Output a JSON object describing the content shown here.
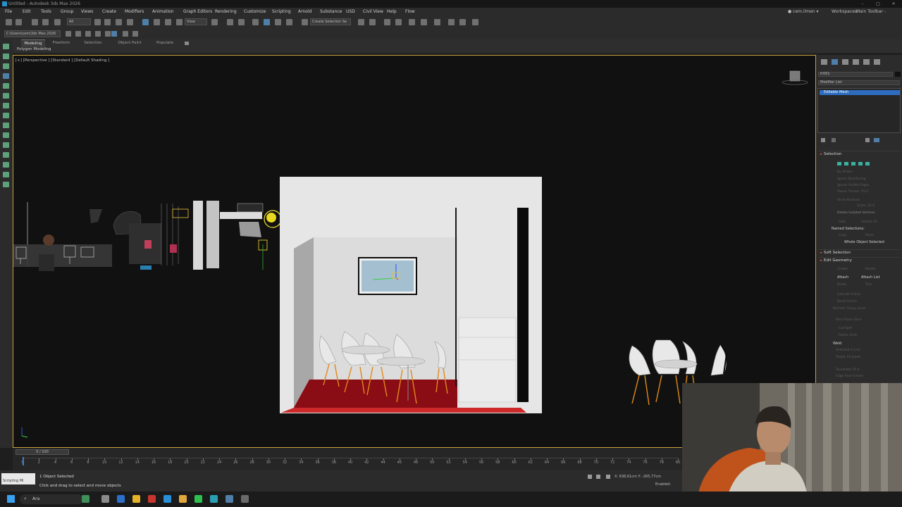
{
  "window": {
    "title": "Untitled - Autodesk 3ds Max 2026"
  },
  "menu": {
    "items": [
      "File",
      "Edit",
      "Tools",
      "Group",
      "Views",
      "Create",
      "Modifiers",
      "Animation",
      "Graph Editors",
      "Rendering",
      "Customize",
      "Scripting",
      "Arnold",
      "Substance",
      "USD",
      "Civil View",
      "Help",
      "Flow"
    ],
    "user": "cem.ilmen",
    "workspaces_label": "Workspaces:",
    "workspace_value": "Main Toolbar - modular"
  },
  "toolbar": {
    "filter_value": "All",
    "view_value": "View",
    "selection_set_placeholder": "Create Selection Se",
    "project_path": "C:\\Users\\cem\\3ds Max 2026"
  },
  "ribbon": {
    "tabs": [
      "Modeling",
      "Freeform",
      "Selection",
      "Object Paint",
      "Populate"
    ],
    "active_panel": "Polygon Modeling"
  },
  "viewport": {
    "label": "[+] [Perspective ] [Standard ] [Default Shading ]"
  },
  "command_panel": {
    "object_name": "tr001",
    "modifier_list_label": "Modifier List",
    "stack_item": "Editable Mesh",
    "rollouts": {
      "selection": "Selection",
      "soft_selection": "Soft Selection",
      "edit_geometry": "Edit Geometry"
    },
    "selection_options": [
      "By Vertex",
      "Ignore Backfacing",
      "Ignore Visible Edges",
      "Planar Thresh: 45.0",
      "Show Normals",
      "Scale: 20.0",
      "Delete Isolated Vertices"
    ],
    "hide_label": "Hide",
    "unhide_all_label": "Unhide All",
    "copy_label": "Copy",
    "paste_label": "Paste",
    "named_selections_label": "Named Selections:",
    "selection_status": "Whole Object Selected",
    "edit_geometry_buttons": [
      [
        "Create",
        "Delete"
      ],
      [
        "Attach",
        "Attach List"
      ],
      [
        "Break",
        "Turn"
      ]
    ],
    "edit_geometry_fields": [
      "Extrude 0.0cm",
      "Bevel 0.0cm",
      "Normal: Group Local",
      "Slice Plane  Slice",
      "Cut  Split",
      "Refine Ends"
    ],
    "weld_label": "Weld",
    "weld_selected": "Selected  0.1cm",
    "weld_target": "Target  10  pixels",
    "tessellate_label": "Tessellate  25.0",
    "tessellate_opts": "Edge   Face-Center"
  },
  "timeline": {
    "frame_counter": "0 / 100",
    "ticks": [
      "0",
      "2",
      "4",
      "6",
      "8",
      "10",
      "12",
      "14",
      "16",
      "18",
      "20",
      "22",
      "24",
      "26",
      "28",
      "30",
      "32",
      "34",
      "36",
      "38",
      "40",
      "42",
      "44",
      "46",
      "48",
      "50",
      "52",
      "54",
      "56",
      "58",
      "60",
      "62",
      "64",
      "66",
      "68",
      "70",
      "72",
      "74",
      "76",
      "78",
      "80"
    ]
  },
  "status": {
    "selection": "1 Object Selected",
    "prompt": "Click and drag to select and move objects",
    "script_label": "Scripting Mi",
    "coords": "X: 638,61cm  Y: -265,77cm",
    "enabled_label": "Enabled:"
  },
  "taskbar": {
    "search_placeholder": "Ara"
  }
}
